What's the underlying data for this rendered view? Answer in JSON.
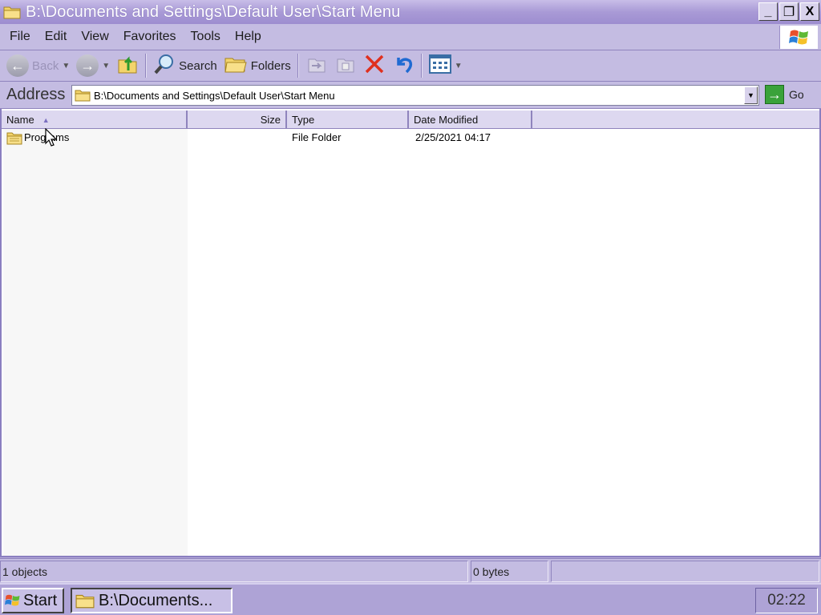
{
  "window": {
    "title": "B:\\Documents and Settings\\Default User\\Start Menu",
    "buttons": {
      "minimize": "_",
      "restore": "❐",
      "close": "X"
    }
  },
  "menu": [
    "File",
    "Edit",
    "View",
    "Favorites",
    "Tools",
    "Help"
  ],
  "toolbar": {
    "back_label": "Back",
    "search_label": "Search",
    "folders_label": "Folders"
  },
  "address": {
    "label": "Address",
    "value": "B:\\Documents and Settings\\Default User\\Start Menu",
    "go_label": "Go"
  },
  "columns": {
    "name": "Name",
    "size": "Size",
    "type": "Type",
    "date": "Date Modified"
  },
  "files": [
    {
      "name": "Programs",
      "size": "",
      "type": "File Folder",
      "date": "2/25/2021 04:17"
    }
  ],
  "status": {
    "objects": "1 objects",
    "size": "0 bytes"
  },
  "taskbar": {
    "start_label": "Start",
    "task_label": "B:\\Documents...",
    "clock": "02:22"
  },
  "colors": {
    "titlebar": "#a99ad6",
    "chrome": "#c4bce2",
    "taskbar": "#aea3d6"
  }
}
